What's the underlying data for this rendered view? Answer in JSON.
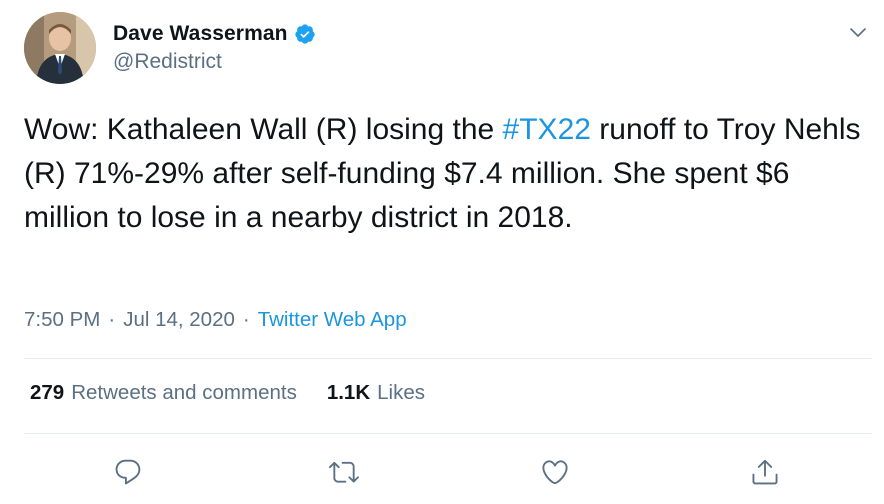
{
  "author": {
    "display_name": "Dave Wasserman",
    "handle": "@Redistrict",
    "verified": true,
    "avatar_icon": "profile-photo"
  },
  "tweet": {
    "text_before": "Wow: Kathaleen Wall (R) losing the ",
    "hashtag": "#TX22",
    "text_after": " runoff to Troy Nehls (R) 71%-29% after self-funding $7.4 million. She spent $6 million to lose in a nearby district in 2018."
  },
  "meta": {
    "time": "7:50 PM",
    "separator": "·",
    "date": "Jul 14, 2020",
    "source": "Twitter Web App"
  },
  "stats": {
    "retweets_count": "279",
    "retweets_label": "Retweets and comments",
    "likes_count": "1.1K",
    "likes_label": "Likes"
  },
  "actions": {
    "reply_icon": "reply-icon",
    "retweet_icon": "retweet-icon",
    "like_icon": "heart-icon",
    "share_icon": "share-icon"
  },
  "colors": {
    "accent": "#1b95e0",
    "secondary_text": "#5b7083",
    "primary_text": "#0f1419",
    "divider": "#e6ecf0"
  }
}
